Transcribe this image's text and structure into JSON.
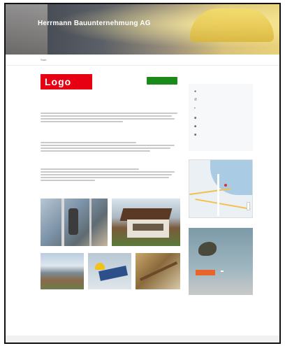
{
  "header": {
    "title": "Herrmann Bauunternehmung AG",
    "subtitle": ""
  },
  "topnav": {
    "left": "Start",
    "right": ""
  },
  "breadcrumb": "",
  "main": {
    "logo_text": "Logo",
    "cta_label": "",
    "heading": "",
    "section_2_heading": "",
    "section_3_heading": "",
    "footer_heading": "",
    "footer_subheading": "",
    "footer_items": [
      "",
      "",
      "",
      "",
      ""
    ]
  },
  "sidebar": {
    "contact": [
      {
        "icon": "location-icon",
        "label": "",
        "value": ""
      },
      {
        "icon": "phone-icon",
        "label": "",
        "value": ""
      },
      {
        "icon": "fax-icon",
        "label": "",
        "value": ""
      },
      {
        "icon": "email-icon",
        "label": "",
        "value": ""
      },
      {
        "icon": "web-icon",
        "label": "",
        "value": ""
      },
      {
        "icon": "vcard-icon",
        "label": "",
        "value": ""
      }
    ],
    "ad": {
      "text": "",
      "button": "",
      "brand": ""
    }
  },
  "colors": {
    "logo_red": "#e60012",
    "cta_green": "#1b8a1b",
    "ad_orange": "#e8642a"
  }
}
